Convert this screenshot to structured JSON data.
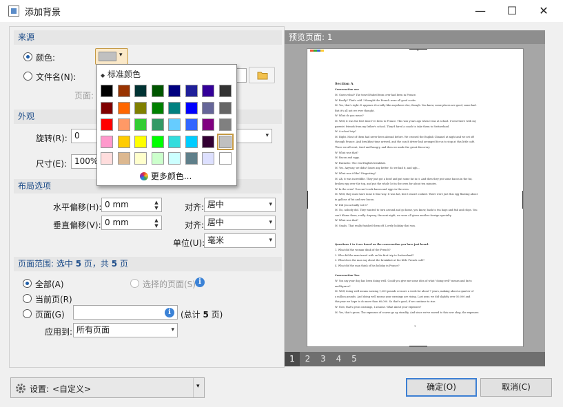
{
  "window": {
    "title": "添加背景",
    "minimize": "—",
    "maximize": "☐",
    "close": "✕"
  },
  "source": {
    "header": "来源",
    "color_label": "颜色:",
    "file_label": "文件名(N):",
    "page_label": "页面:",
    "selected_color": "#c0c0c0"
  },
  "appearance": {
    "header": "外观",
    "rotate_label": "旋转(R):",
    "rotate_value": "0",
    "size_label": "尺寸(E):",
    "size_value": "100%"
  },
  "layout": {
    "header": "布局选项",
    "h_offset_label": "水平偏移(H):",
    "h_offset_value": "0 mm",
    "v_offset_label": "垂直偏移(V):",
    "v_offset_value": "0 mm",
    "align_label_1": "对齐:",
    "align_value_1": "居中",
    "align_label_2": "对齐:",
    "align_value_2": "居中",
    "unit_label": "单位(U):",
    "unit_value": "毫米"
  },
  "range": {
    "header_prefix": "页面范围: 选中 ",
    "selected_count": "5",
    "header_middle": " 页，共 ",
    "total_count": "5",
    "header_suffix": " 页",
    "all_label": "全部(A)",
    "selected_pages_label": "选择的页面(S)",
    "current_label": "当前页(R)",
    "pages_label": "页面(G)",
    "pages_value": "",
    "total_prefix": "(总计 ",
    "total_pages": "5",
    "total_suffix": " 页)",
    "apply_label": "应用到:",
    "apply_value": "所有页面"
  },
  "color_popup": {
    "title": "标准颜色",
    "more_colors": "更多颜色...",
    "colors": [
      "#000000",
      "#993300",
      "#003333",
      "#005500",
      "#000080",
      "#1f1f99",
      "#330099",
      "#333333",
      "#800000",
      "#ff6600",
      "#808000",
      "#008000",
      "#008080",
      "#0000ff",
      "#666699",
      "#666666",
      "#ff0000",
      "#ff9966",
      "#33cc33",
      "#339966",
      "#66ccff",
      "#3366ff",
      "#800080",
      "#808080",
      "#ff99cc",
      "#ffcc00",
      "#ffff00",
      "#00ff00",
      "#33dddd",
      "#00ccff",
      "#330033",
      "#c0c0c0",
      "#ffdddd",
      "#dcb890",
      "#ffffcc",
      "#ccffcc",
      "#ccffff",
      "#5f7f8a",
      "#dde0ff",
      "#ffffff"
    ],
    "selected_index": 31
  },
  "preview": {
    "title": "预览页面: 1",
    "pages": [
      "1",
      "2",
      "3",
      "4",
      "5"
    ],
    "current_page": "1",
    "doc_title": "Section A",
    "doc_subtitle": "Conversation one",
    "lines": [
      "M:  Guess what? The travel Ended from over had been in France.",
      "W:  Really? That's odd. I thought the French were all good cooks.",
      "M:  Yes, that's right. It appears it's really like anywhere else, though. You know, some places are good, some bad.",
      "     But it's all not we ever thought.",
      "W:  What do you mean?",
      "M:  Well, it was the first time I've been to France. This was years ago when I was at school. I went there with my",
      "     parents' friends from my father's school. They'd hired a coach to take them to Switzerland.",
      "W:  A school trip?",
      "M:  Right. Most of them had never been abroad before. We crossed the English Channel at night and we set off",
      "     through France. And breakfast time arrived, and the coach driver had arranged for us to stop at this little café.",
      "     There we all went, tired and hungry, and then we made the great discovery.",
      "W:  What was that?",
      "M:  Bacon and eggs.",
      "W:  Fantastic. The real English breakfast.",
      "M:  Yes. Anyway, we didn't know any better. So we had it, and ugh...",
      "W:  What was it like? Disgusting?",
      "M:  Ah, it was incredible. They just got a bowl and put some fat in it. And then they put some bacon in the fat,",
      "     broken egg over the top, and put the whole lot in the oven for about ten minutes.",
      "W:  In the oven? You can't cook bacon and eggs in the oven.",
      "M:  Well, they must have done it that way. It was hot, but it wasn't cooked. There were just this egg floating about",
      "     in gallons of fat and raw bacon.",
      "W:  Did you actually eat it?",
      "M:  No, nobody did. They wanted to turn around and go home, you know, back to tea bags and fish and chips. You",
      "     can't blame them, really. Anyway, the next night, we were all given another foreign specialty.",
      "W:  What was that?",
      "M:  Snails. That really finished them off. Lovely holiday that was."
    ],
    "questions_title": "Questions 1 to 4 are based on the conversation you have just heard.",
    "questions": [
      "1.  What did the woman think of the French?",
      "2.  Who did the man travel with on his first trip to Switzerland?",
      "3.  What does the man say about the breakfast at the little French café?",
      "4.  What did the man think of his holiday in France?"
    ],
    "conv2_title": "Conversation Two",
    "conv2_lines": [
      "W:  You say your dog has been doing well. Could you give me some idea of what \"doing well\" means and facts",
      "     and figures?",
      "M:  Well, doing well means earning 1,200 pounds or more a week for about 7 years, making about a quarter of",
      "     a million pounds. And doing well means your earnings are rising. Last year, we did slightly over 50,000 and",
      "     this year we hope to do more than 60,000. So that's good, if we continue to rise.",
      "W:  Now, that's gross earnings, I assume. What about your expenses?",
      "M:  Yes, that's gross. The expenses of course go up steadily. And since we've moved to this new shop, the expenses"
    ],
    "page_number": "1"
  },
  "footer": {
    "settings_label": "设置:",
    "settings_value": "<自定义>",
    "ok_label": "确定(O)",
    "cancel_label": "取消(C)"
  }
}
